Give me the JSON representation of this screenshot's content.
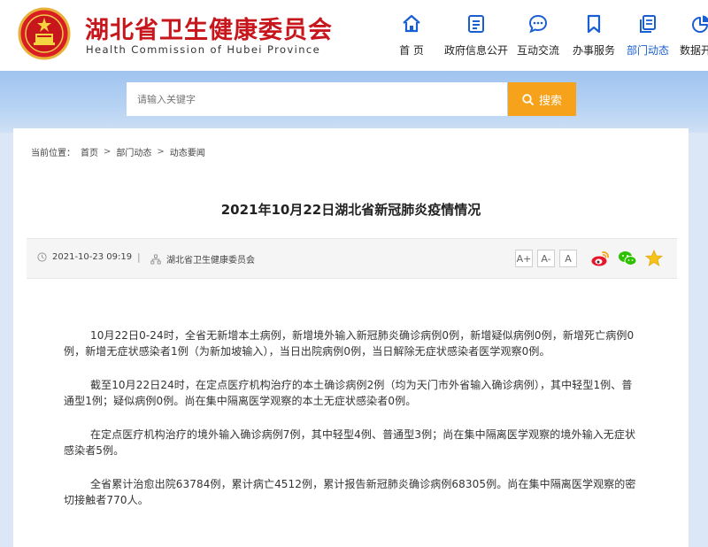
{
  "header": {
    "site_title": "湖北省卫生健康委员会",
    "site_subtitle": "Health Commission of Hubei Province",
    "brand_color": "#c8161d"
  },
  "nav": {
    "accent_color": "#1a5fd2",
    "items": [
      {
        "label": "首 页",
        "icon": "home-icon"
      },
      {
        "label": "政府信息公开",
        "icon": "document-list-icon"
      },
      {
        "label": "互动交流",
        "icon": "chat-bubble-icon"
      },
      {
        "label": "办事服务",
        "icon": "bookmark-icon"
      },
      {
        "label": "部门动态",
        "icon": "news-pages-icon",
        "active": true
      },
      {
        "label": "数据开放",
        "icon": "pie-chart-icon"
      }
    ]
  },
  "search": {
    "placeholder": "请输入关键字",
    "button_label": "搜索",
    "button_color": "#f7a21b"
  },
  "breadcrumb": {
    "prefix": "当前位置：",
    "items": [
      "首页",
      "部门动态",
      "动态要闻"
    ],
    "separator": ">"
  },
  "article": {
    "title": "2021年10月22日湖北省新冠肺炎疫情情况",
    "datetime": "2021-10-23 09:19",
    "divider": "|",
    "source": "湖北省卫生健康委员会",
    "font_sizes": [
      "A+",
      "A-",
      "A"
    ],
    "share_icons": [
      "weibo-icon",
      "wechat-icon",
      "favorite-star-icon"
    ],
    "paragraphs": [
      "10月22日0-24时，全省无新增本土病例，新增境外输入新冠肺炎确诊病例0例，新增疑似病例0例，新增死亡病例0例，新增无症状感染者1例（为新加坡输入），当日出院病例0例，当日解除无症状感染者医学观察0例。",
      "截至10月22日24时，在定点医疗机构治疗的本土确诊病例2例（均为天门市外省输入确诊病例），其中轻型1例、普通型1例；疑似病例0例。尚在集中隔离医学观察的本土无症状感染者0例。",
      "在定点医疗机构治疗的境外输入确诊病例7例，其中轻型4例、普通型3例；尚在集中隔离医学观察的境外输入无症状感染者5例。",
      "全省累计治愈出院63784例，累计病亡4512例，累计报告新冠肺炎确诊病例68305例。尚在集中隔离医学观察的密切接触者770人。"
    ]
  }
}
